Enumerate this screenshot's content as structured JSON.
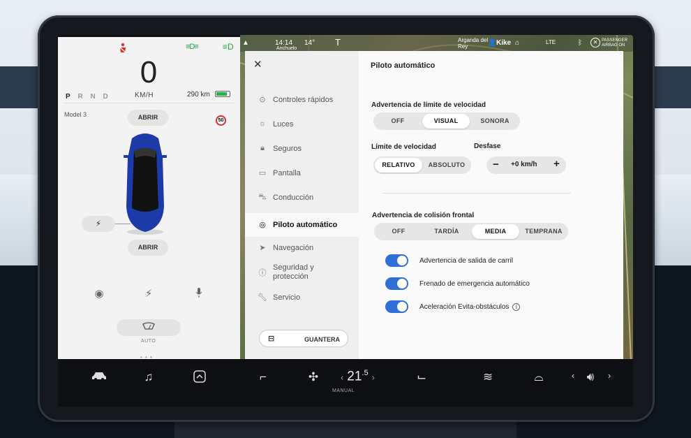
{
  "car": {
    "speed": "0",
    "unit": "KM/H",
    "gear_p": "P",
    "gear_rest": "R N D",
    "range": "290 km",
    "model": "Model 3",
    "open_front": "ABRIR",
    "open_rear": "ABRIR",
    "speed_sign": "50",
    "wiper_label": "AUTO",
    "page_dots": "• • •"
  },
  "status_bar": {
    "time": "14:14",
    "time_sub": "Anchuelo",
    "temp": "14°",
    "place": "Arganda del Rey",
    "user": "Kike",
    "network": "LTE",
    "airbag": "PASSENGER AIRBAG ON"
  },
  "settings": {
    "close": "✕",
    "title": "Piloto automático",
    "nav": [
      {
        "label": "Controles rápidos",
        "icon": "toggle-icon"
      },
      {
        "label": "Luces",
        "icon": "light-icon"
      },
      {
        "label": "Seguros",
        "icon": "lock-icon"
      },
      {
        "label": "Pantalla",
        "icon": "display-icon"
      },
      {
        "label": "Conducción",
        "icon": "car-icon"
      },
      {
        "label": "Piloto automático",
        "icon": "steering-wheel-icon"
      },
      {
        "label": "Navegación",
        "icon": "navigation-icon"
      },
      {
        "label": "Seguridad y protección",
        "icon": "alert-icon"
      },
      {
        "label": "Servicio",
        "icon": "wrench-icon"
      }
    ],
    "glovebox": "GUANTERA",
    "speed_warning": {
      "label": "Advertencia de límite de velocidad",
      "options": [
        "OFF",
        "VISUAL",
        "SONORA"
      ],
      "selected": "VISUAL"
    },
    "speed_limit": {
      "label": "Límite de velocidad",
      "options": [
        "RELATIVO",
        "ABSOLUTO"
      ],
      "selected": "RELATIVO"
    },
    "offset": {
      "label": "Desfase",
      "minus": "−",
      "value": "+0 km/h",
      "plus": "+"
    },
    "collision": {
      "label": "Advertencia de colisión frontal",
      "options": [
        "OFF",
        "TARDÍA",
        "MEDIA",
        "TEMPRANA"
      ],
      "selected": "MEDIA"
    },
    "toggles": [
      {
        "label": "Advertencia de salida de carril",
        "on": true
      },
      {
        "label": "Frenado de emergencia automático",
        "on": true
      },
      {
        "label": "Aceleración Evita-obstáculos",
        "on": true
      }
    ],
    "info_glyph": "i"
  },
  "dock": {
    "temp_main": "21",
    "temp_dec": ".5",
    "climate_mode": "MANUAL"
  },
  "colors": {
    "accent": "#2f6fd6",
    "battery": "#25b34b",
    "warning": "#d8312c"
  }
}
